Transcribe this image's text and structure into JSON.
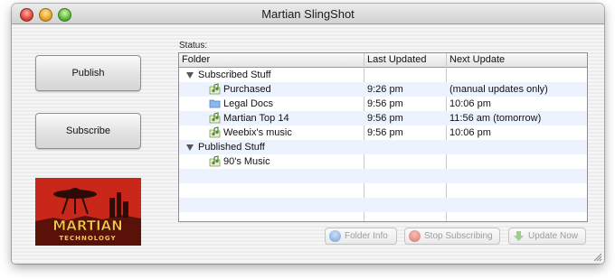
{
  "window": {
    "title": "Martian SlingShot"
  },
  "sidebar": {
    "publish_label": "Publish",
    "subscribe_label": "Subscribe",
    "logo": {
      "line1": "MARTIAN",
      "line2": "TECHNOLOGY"
    }
  },
  "status": {
    "label": "Status:",
    "columns": [
      "Folder",
      "Last Updated",
      "Next Update"
    ],
    "rows": [
      {
        "type": "group",
        "folder": "Subscribed Stuff",
        "last": "",
        "next": ""
      },
      {
        "type": "item",
        "icon": "music-folder-icon",
        "folder": "Purchased",
        "last": "9:26 pm",
        "next": "(manual updates only)"
      },
      {
        "type": "item",
        "icon": "folder-icon",
        "folder": "Legal Docs",
        "last": "9:56 pm",
        "next": "10:06 pm"
      },
      {
        "type": "item",
        "icon": "music-folder-icon",
        "folder": "Martian Top 14",
        "last": "9:56 pm",
        "next": "11:56 am (tomorrow)"
      },
      {
        "type": "item",
        "icon": "music-folder-icon",
        "folder": "Weebix's music",
        "last": "9:56 pm",
        "next": "10:06 pm"
      },
      {
        "type": "group",
        "folder": "Published Stuff",
        "last": "",
        "next": ""
      },
      {
        "type": "item",
        "icon": "music-folder-icon",
        "folder": "90's Music",
        "last": "",
        "next": ""
      }
    ]
  },
  "actions": {
    "folder_info": "Folder Info",
    "stop_subscribing": "Stop Subscribing",
    "update_now": "Update Now"
  },
  "colors": {
    "alt_row": "#edf3fe",
    "logo_red": "#c8271a"
  }
}
